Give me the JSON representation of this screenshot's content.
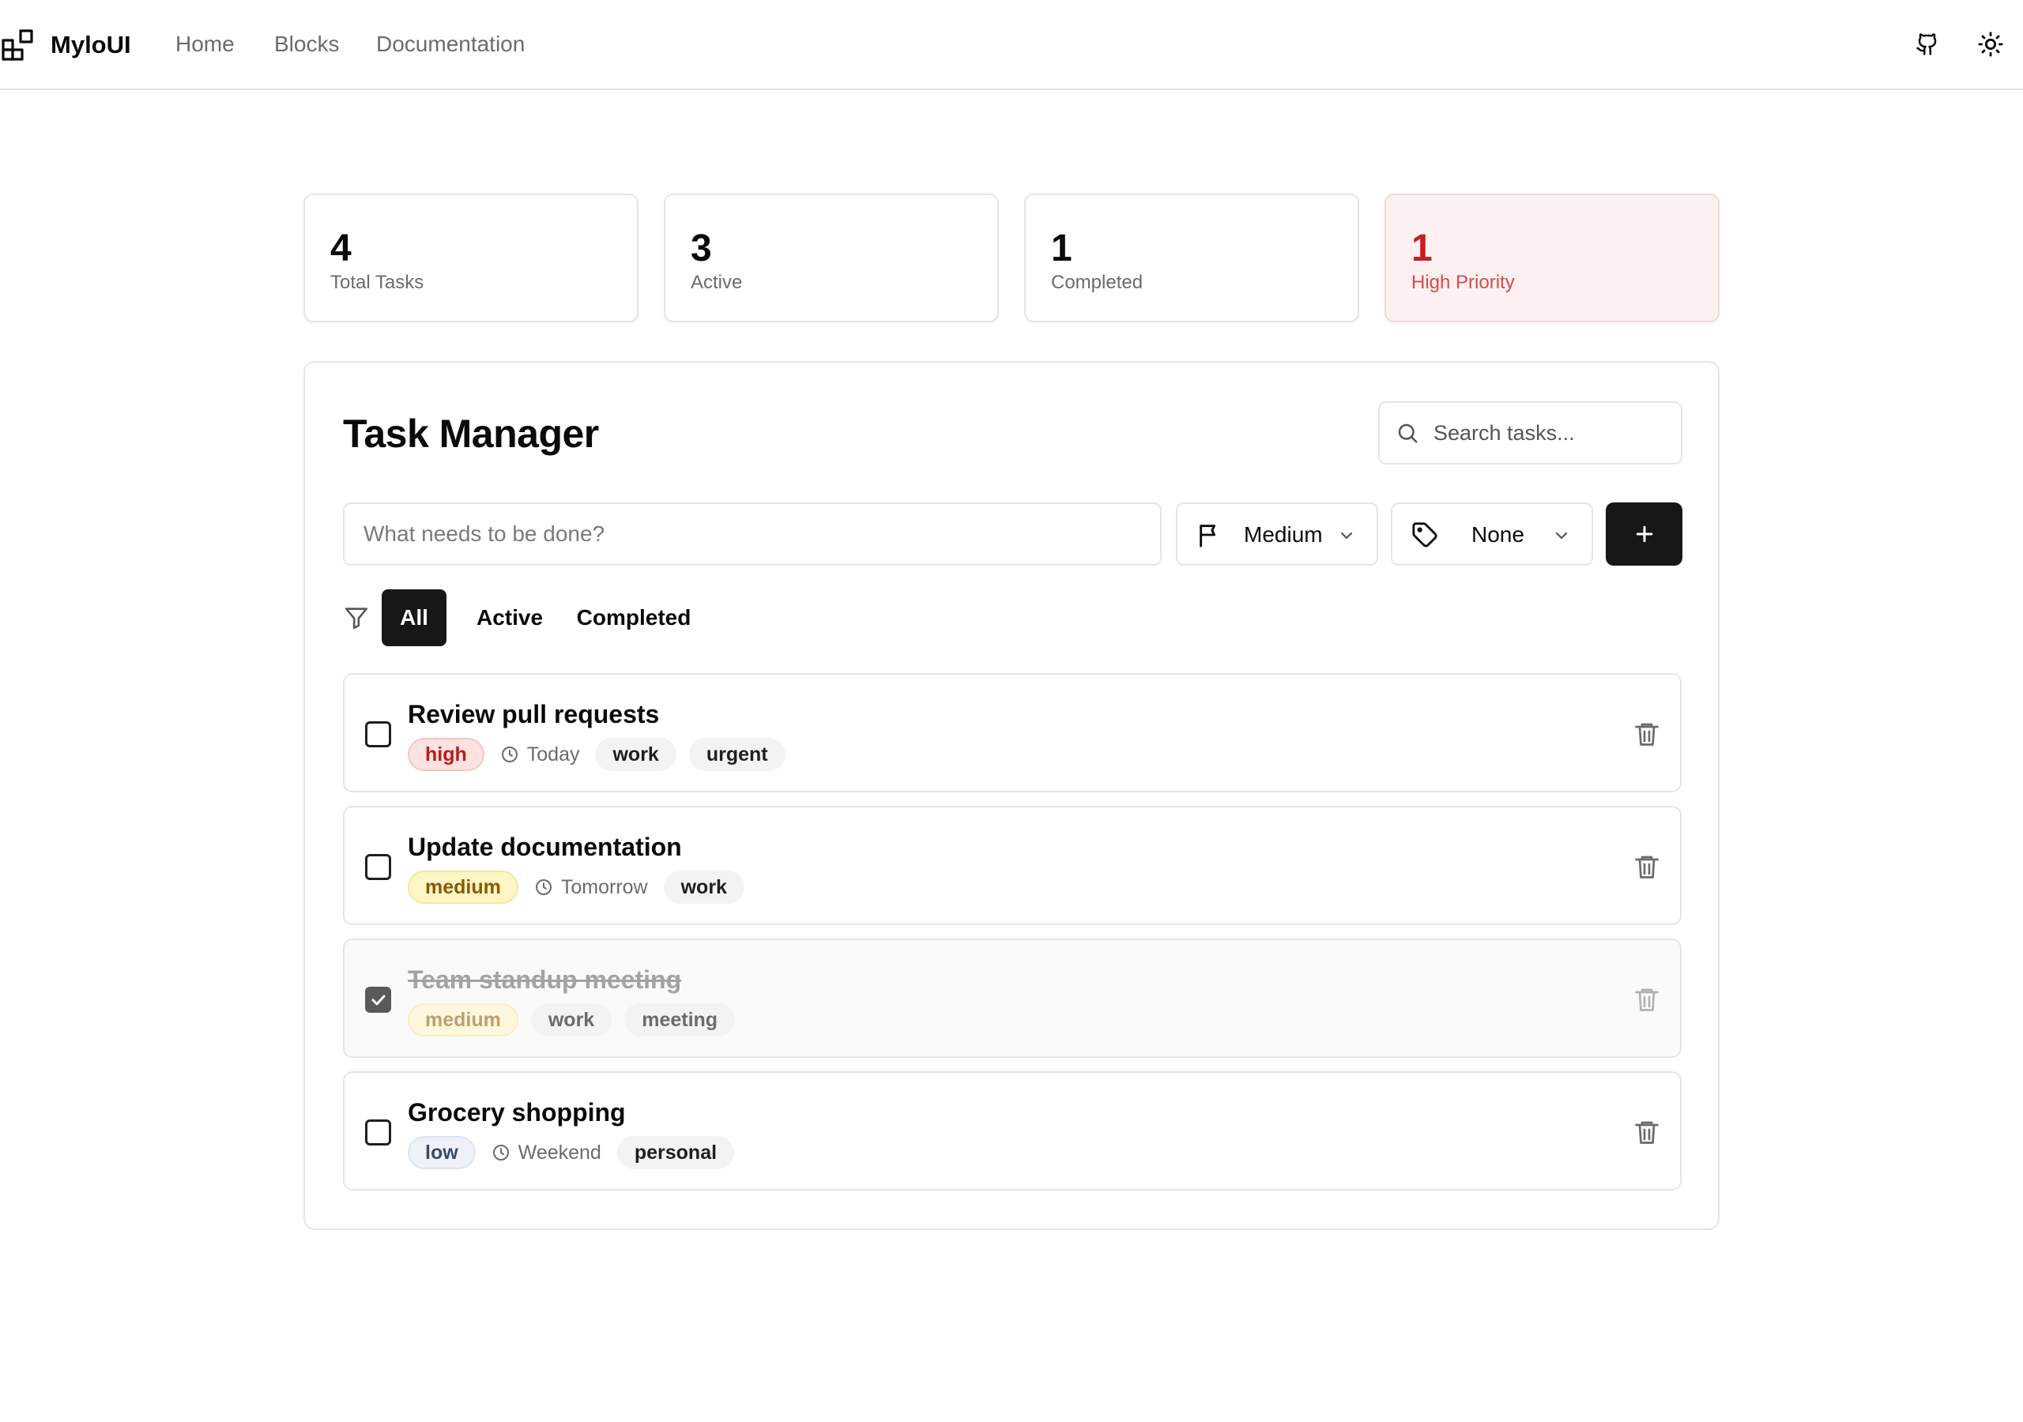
{
  "brand": {
    "name": "MyloUI",
    "logo_icon": "blocks-icon"
  },
  "nav": {
    "home": "Home",
    "blocks": "Blocks",
    "documentation": "Documentation"
  },
  "header_actions": {
    "github_icon": "github-icon",
    "theme_icon": "sun-icon"
  },
  "stats": [
    {
      "value": "4",
      "label": "Total Tasks"
    },
    {
      "value": "3",
      "label": "Active"
    },
    {
      "value": "1",
      "label": "Completed"
    },
    {
      "value": "1",
      "label": "High Priority",
      "accent": "#c81e1e"
    }
  ],
  "manager": {
    "title": "Task Manager",
    "search_placeholder": "Search tasks...",
    "new_task_placeholder": "What needs to be done?",
    "priority_select": "Medium",
    "tag_select": "None",
    "add_icon": "plus-icon"
  },
  "filters": {
    "all": "All",
    "active": "Active",
    "completed": "Completed",
    "selected": "All"
  },
  "tasks": [
    {
      "title": "Review pull requests",
      "priority": "high",
      "due": "Today",
      "tags": [
        "work",
        "urgent"
      ],
      "completed": false
    },
    {
      "title": "Update documentation",
      "priority": "medium",
      "due": "Tomorrow",
      "tags": [
        "work"
      ],
      "completed": false
    },
    {
      "title": "Team standup meeting",
      "priority": "medium",
      "due": "",
      "tags": [
        "work",
        "meeting"
      ],
      "completed": true
    },
    {
      "title": "Grocery shopping",
      "priority": "low",
      "due": "Weekend",
      "tags": [
        "personal"
      ],
      "completed": false
    }
  ],
  "colors": {
    "primary": "#171717",
    "high": "#b91c1c",
    "medium": "#8a5a00",
    "low": "#3b4a66",
    "border": "#e5e5e5"
  }
}
